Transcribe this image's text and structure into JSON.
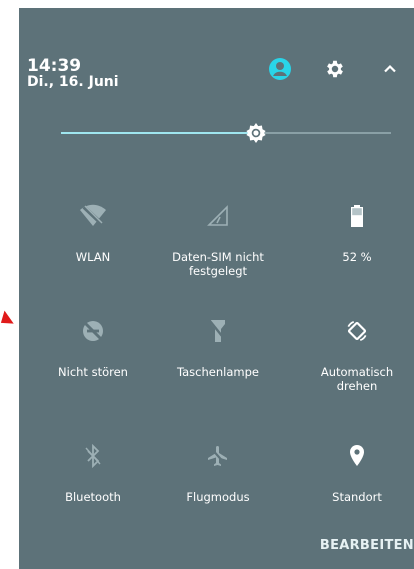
{
  "header": {
    "time": "14:39",
    "date": "Di., 16. Juni",
    "icons": [
      "account-icon",
      "settings-gear-icon",
      "chevron-up-icon"
    ]
  },
  "brightness": {
    "level": 0.59,
    "accent": "#9fe6ef"
  },
  "tiles": [
    {
      "id": "wlan",
      "label": "WLAN",
      "icon": "wifi-off-icon"
    },
    {
      "id": "mobile-data",
      "label": "Daten-SIM nicht festgelegt",
      "icon": "signal-icon"
    },
    {
      "id": "battery",
      "label": "52 %",
      "icon": "battery-icon"
    },
    {
      "id": "dnd",
      "label": "Nicht stören",
      "icon": "do-not-disturb-off-icon"
    },
    {
      "id": "flashlight",
      "label": "Taschenlampe",
      "icon": "flashlight-off-icon"
    },
    {
      "id": "rotate",
      "label": "Automatisch drehen",
      "icon": "auto-rotate-icon"
    },
    {
      "id": "bluetooth",
      "label": "Bluetooth",
      "icon": "bluetooth-off-icon"
    },
    {
      "id": "airplane",
      "label": "Flugmodus",
      "icon": "airplane-mode-icon"
    },
    {
      "id": "location",
      "label": "Standort",
      "icon": "location-pin-icon"
    }
  ],
  "footer": {
    "edit_label": "BEARBEITEN"
  },
  "colors": {
    "panel": "#5d7279",
    "accent": "#29d4e8",
    "dim_icon": "#9db0b5"
  }
}
